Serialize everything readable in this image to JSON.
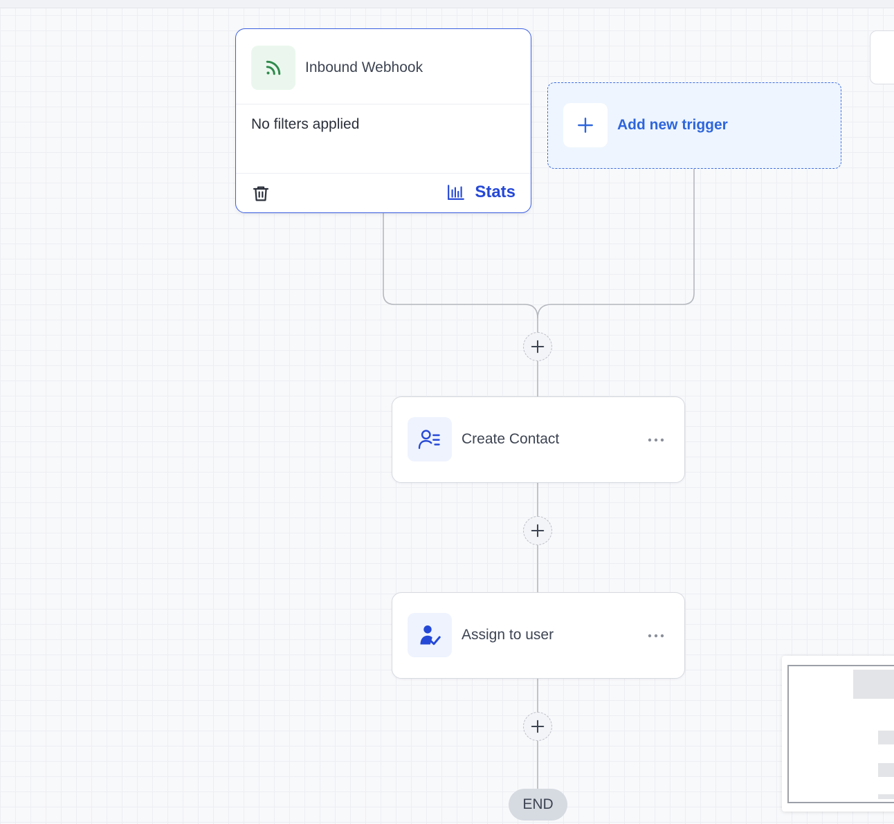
{
  "trigger": {
    "title": "Inbound Webhook",
    "icon": "rss-icon",
    "filters_text": "No filters applied",
    "delete_icon": "trash-icon",
    "stats_label": "Stats",
    "stats_icon": "bar-chart-icon"
  },
  "add_trigger": {
    "label": "Add new trigger",
    "icon": "plus-icon"
  },
  "actions": [
    {
      "label": "Create Contact",
      "icon": "contact-list-icon"
    },
    {
      "label": "Assign to user",
      "icon": "user-check-icon"
    }
  ],
  "end_label": "END",
  "colors": {
    "accent": "#2548d6",
    "trigger_border": "#3b5fe0",
    "add_trigger_bg": "#eef5fe",
    "webhook_green": "#2f8a4c",
    "connector": "#b4b7bd"
  }
}
